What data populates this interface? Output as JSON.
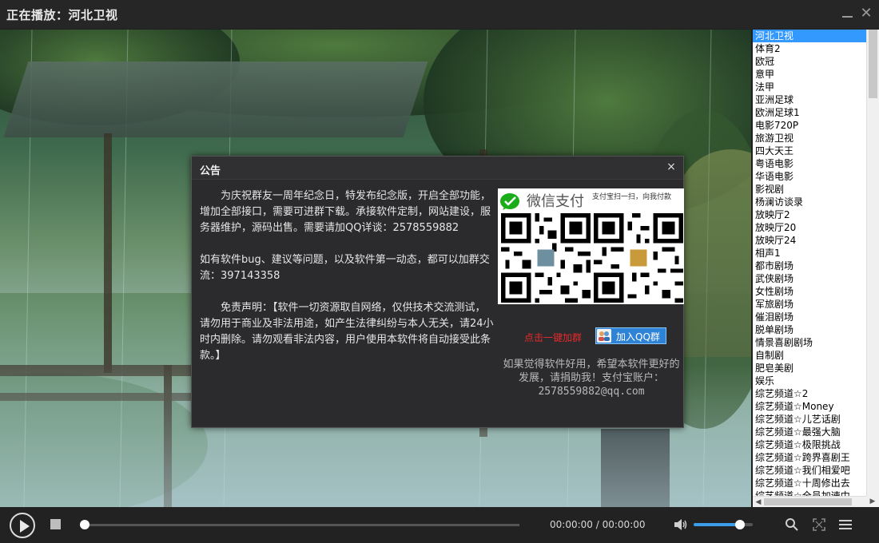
{
  "titlebar": {
    "title": "正在播放：河北卫视",
    "minimize_icon": "minimize-icon",
    "close_glyph": "✕"
  },
  "channels": {
    "selected_index": 0,
    "items": [
      "河北卫视",
      "体育2",
      "欧冠",
      "意甲",
      "法甲",
      "亚洲足球",
      "欧洲足球1",
      "电影720P",
      "旅游卫视",
      "四大天王",
      "粤语电影",
      "华语电影",
      "影视剧",
      "杨澜访谈录",
      "放映厅2",
      "放映厅20",
      "放映厅24",
      "相声1",
      "都市剧场",
      "武侠剧场",
      "女性剧场",
      "军旅剧场",
      "催泪剧场",
      "脱单剧场",
      "情景喜剧剧场",
      "自制剧",
      "肥皂美剧",
      "娱乐",
      "综艺频道☆2",
      "综艺频道☆Money",
      "综艺频道☆儿艺话剧",
      "综艺频道☆最强大脑",
      "综艺频道☆极限挑战",
      "综艺频道☆跨界喜剧王",
      "综艺频道☆我们相爱吧",
      "综艺频道☆十周修出去",
      "综艺频道☆全员加速中"
    ]
  },
  "dialog": {
    "title": "公告",
    "close_glyph": "×",
    "paragraph1": "为庆祝群友一周年纪念日，特发布纪念版，开启全部功能，增加全部接口，需要可进群下载。承接软件定制，网站建设，服务器维护，源码出售。需要请加QQ详谈：2578559882",
    "paragraph2": "如有软件bug、建议等问题，以及软件第一动态，都可以加群交流：397143358",
    "paragraph3": "免责声明：【软件一切资源取自网络，仅供技术交流测试，请勿用于商业及非法用途，如产生法律纠纷与本人无关，请24小时内删除。请勿观看非法内容，用户使用本软件将自动接受此条款。】",
    "pay_brand": "微信支付",
    "pay_note": "支付宝扫一扫，向我付款",
    "join_link": "点击一键加群",
    "qq_button": "加入QQ群",
    "donate_text": "如果觉得软件好用，希望本软件更好的发展，请捐助我！支付宝账户：2578559882@qq.com"
  },
  "controls": {
    "current_time": "00:00:00",
    "separator": "/",
    "total_time": "00:00:00",
    "progress_fraction": 0.0,
    "volume_fraction": 0.78,
    "icons": [
      "play-icon",
      "stop-icon",
      "volume-icon",
      "search-icon",
      "fullscreen-icon",
      "menu-icon"
    ]
  },
  "colors": {
    "accent": "#3a9fe8",
    "selection": "#3399ff",
    "link_red": "#e52a2a",
    "wechat_green": "#1aad19"
  }
}
